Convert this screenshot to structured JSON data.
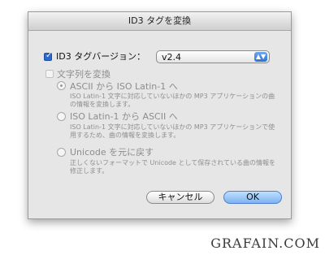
{
  "window": {
    "title": "ID3 タグを変換"
  },
  "id3_version": {
    "checkbox_label": "ID3 タグバージョン：",
    "selected_value": "v2.4",
    "checked": true
  },
  "convert_strings": {
    "label": "文字列を変換",
    "options": [
      {
        "label": "ASCII から ISO Latin-1 へ",
        "description": "ISO Latin-1 文字に対応していないほかの MP3 アプリケーションの曲の情報を変換します。",
        "selected": true
      },
      {
        "label": "ISO Latin-1 から ASCII へ",
        "description": "ISO Latin-1 文字に対応していないほかの MP3 アプリケーションで使用するため、曲の情報を変換します。",
        "selected": false
      },
      {
        "label": "Unicode を元に戻す",
        "description": "正しくないフォーマットで Unicode として保存されている曲の情報を修正します。",
        "selected": false
      }
    ]
  },
  "buttons": {
    "cancel": "キャンセル",
    "ok": "OK"
  },
  "watermark": "GRAFAIN.COM"
}
